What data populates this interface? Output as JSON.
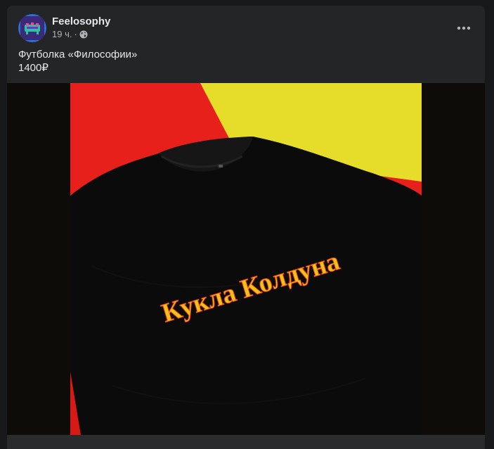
{
  "post": {
    "author": "Feelosophy",
    "time": "19 ч.",
    "separator": "·",
    "privacy_icon": "globe-icon",
    "text_line1": "Футболка «Философии»",
    "text_line2": "1400₽",
    "more_icon": "more-horizontal-icon"
  },
  "photo": {
    "shirt_print": "Кукла Колдуна"
  },
  "colors": {
    "card_bg": "#242526",
    "page_bg": "#18191a",
    "text_primary": "#e4e6eb",
    "text_secondary": "#b0b3b8",
    "bg_red": "#e8201c",
    "bg_yellow": "#e6dc2a",
    "shirt": "#0b0b0b"
  }
}
